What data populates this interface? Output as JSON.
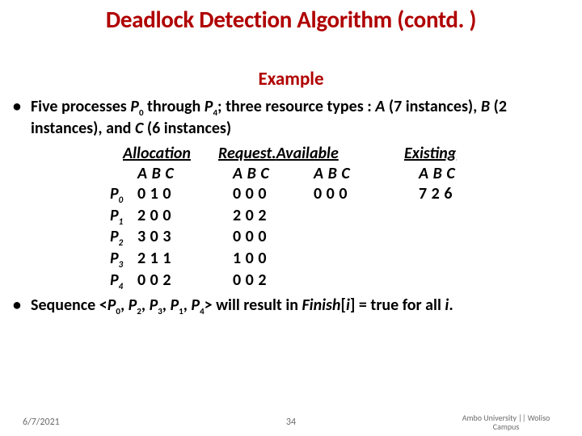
{
  "title": "Deadlock Detection Algorithm (contd. )",
  "subtitle": "Example",
  "bullet1_pre": "Five processes ",
  "bullet1_p0": "P",
  "bullet1_p0s": "0",
  "bullet1_mid1": " through ",
  "bullet1_p4": "P",
  "bullet1_p4s": "4",
  "bullet1_mid2": "; three resource types : ",
  "bullet1_a": "A",
  "bullet1_mid3": " (7 instances), ",
  "bullet1_b": "B",
  "bullet1_mid4": " (2 instances), and ",
  "bullet1_c": "C",
  "bullet1_end": " (6 instances)",
  "headers": {
    "allocation": "Allocation",
    "request": "Request.",
    "available": "Available",
    "existing": "Existing"
  },
  "abc": "A B C",
  "proc_labels": [
    "0",
    "1",
    "2",
    "3",
    "4"
  ],
  "proc_letter": "P",
  "alloc": [
    "0 1 0",
    "2 0 0",
    "3 0 3",
    "2 1 1",
    "0 0 2"
  ],
  "request": [
    "0 0 0",
    "2 0 2",
    "0 0 0",
    "1 0 0",
    "0 0 2"
  ],
  "available": "0 0 0",
  "existing": "7  2  6",
  "seq_pre": "Sequence <",
  "seq_p": "P",
  "seq_order": [
    "0",
    "2",
    "3",
    "1",
    "4"
  ],
  "seq_sep": ", ",
  "seq_post1": "> will result in ",
  "seq_finish": "Finish",
  "seq_post2": "[",
  "seq_i": "i",
  "seq_post3": "] = true for all ",
  "seq_post4": ".",
  "footer": {
    "date": "6/7/2021",
    "page": "34",
    "uni1": "Ambo University || Woliso",
    "uni2": "Campus"
  },
  "chart_data": {
    "type": "table",
    "processes": [
      "P0",
      "P1",
      "P2",
      "P3",
      "P4"
    ],
    "resources": [
      "A",
      "B",
      "C"
    ],
    "allocation": [
      [
        0,
        1,
        0
      ],
      [
        2,
        0,
        0
      ],
      [
        3,
        0,
        3
      ],
      [
        2,
        1,
        1
      ],
      [
        0,
        0,
        2
      ]
    ],
    "request": [
      [
        0,
        0,
        0
      ],
      [
        2,
        0,
        2
      ],
      [
        0,
        0,
        0
      ],
      [
        1,
        0,
        0
      ],
      [
        0,
        0,
        2
      ]
    ],
    "available": [
      0,
      0,
      0
    ],
    "existing": [
      7,
      2,
      6
    ],
    "safe_sequence": [
      "P0",
      "P2",
      "P3",
      "P1",
      "P4"
    ]
  }
}
